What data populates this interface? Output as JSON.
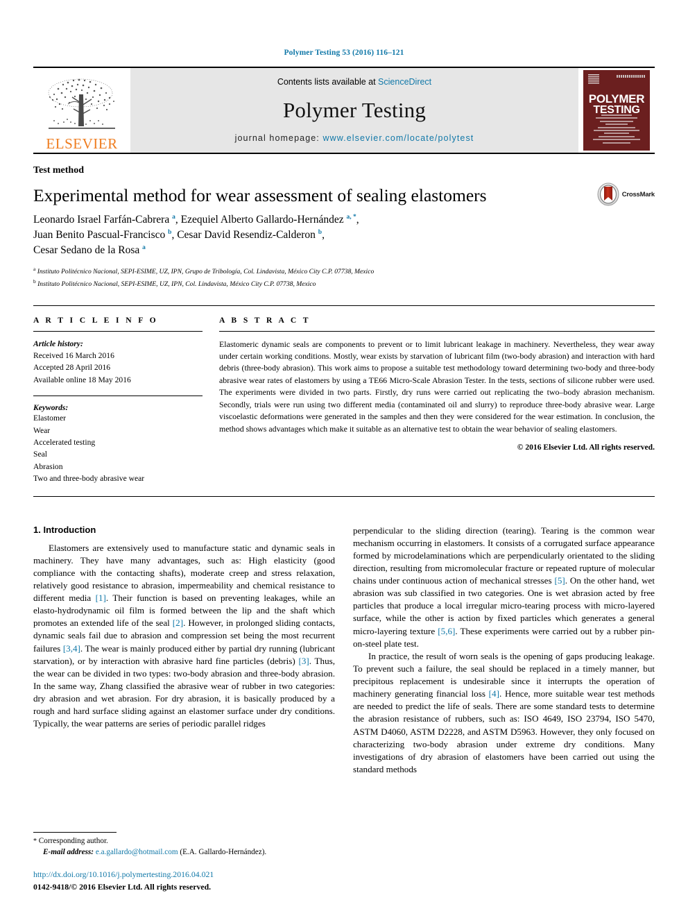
{
  "running_head": "Polymer Testing 53 (2016) 116–121",
  "header": {
    "elsevier_wordmark": "ELSEVIER",
    "contents_prefix": "Contents lists available at ",
    "contents_link": "ScienceDirect",
    "journal_title": "Polymer Testing",
    "homepage_prefix": "journal homepage: ",
    "homepage_url": "www.elsevier.com/locate/polytest",
    "cover": {
      "line1": "POLYMER",
      "line2": "TESTING"
    }
  },
  "article": {
    "type": "Test method",
    "title": "Experimental method for wear assessment of sealing elastomers",
    "crossmark_label": "CrossMark",
    "authors_html": "Leonardo Israel Farfán-Cabrera <sup>a</sup>, Ezequiel Alberto Gallardo-Hernández <sup>a, *</sup>,<br>Juan Benito Pascual-Francisco <sup>b</sup>, Cesar David Resendiz-Calderon <sup>b</sup>,<br>Cesar Sedano de la Rosa <sup>a</sup>",
    "affiliations": [
      {
        "mark": "a",
        "text": "Instituto Politécnico Nacional, SEPI-ESIME, UZ, IPN, Grupo de Tribología, Col. Lindavista, México City C.P. 07738, Mexico"
      },
      {
        "mark": "b",
        "text": "Instituto Politécnico Nacional, SEPI-ESIME, UZ, IPN, Col. Lindavista, México City C.P. 07738, Mexico"
      }
    ]
  },
  "article_info": {
    "heading": "A R T I C L E   I N F O",
    "history_heading": "Article history:",
    "history": [
      "Received 16 March 2016",
      "Accepted 28 April 2016",
      "Available online 18 May 2016"
    ],
    "keywords_heading": "Keywords:",
    "keywords": [
      "Elastomer",
      "Wear",
      "Accelerated testing",
      "Seal",
      "Abrasion",
      "Two and three-body abrasive wear"
    ]
  },
  "abstract": {
    "heading": "A B S T R A C T",
    "text": "Elastomeric dynamic seals are components to prevent or to limit lubricant leakage in machinery. Nevertheless, they wear away under certain working conditions. Mostly, wear exists by starvation of lubricant film (two-body abrasion) and interaction with hard debris (three-body abrasion). This work aims to propose a suitable test methodology toward determining two-body and three-body abrasive wear rates of elastomers by using a TE66 Micro-Scale Abrasion Tester. In the tests, sections of silicone rubber were used. The experiments were divided in two parts. Firstly, dry runs were carried out replicating the two–body abrasion mechanism. Secondly, trials were run using two different media (contaminated oil and slurry) to reproduce three-body abrasive wear. Large viscoelastic deformations were generated in the samples and then they were considered for the wear estimation. In conclusion, the method shows advantages which make it suitable as an alternative test to obtain the wear behavior of sealing elastomers.",
    "copyright": "© 2016 Elsevier Ltd. All rights reserved."
  },
  "introduction": {
    "heading": "1. Introduction",
    "left_paragraphs_html": [
      "Elastomers are extensively used to manufacture static and dynamic seals in machinery. They have many advantages, such as: High elasticity (good compliance with the contacting shafts), moderate creep and stress relaxation, relatively good resistance to abrasion, impermeability and chemical resistance to different media <span class=\"ref\">[1]</span>. Their function is based on preventing leakages, while an elasto-hydrodynamic oil film is formed between the lip and the shaft which promotes an extended life of the seal <span class=\"ref\">[2]</span>. However, in prolonged sliding contacts, dynamic seals fail due to abrasion and compression set being the most recurrent failures <span class=\"ref\">[3,4]</span>. The wear is mainly produced either by partial dry running (lubricant starvation), or by interaction with abrasive hard fine particles (debris) <span class=\"ref\">[3]</span>. Thus, the wear can be divided in two types: two-body abrasion and three-body abrasion. In the same way, Zhang classified the abrasive wear of rubber in two categories: dry abrasion and wet abrasion. For dry abrasion, it is basically produced by a rough and hard surface sliding against an elastomer surface under dry conditions. Typically, the wear patterns are series of periodic parallel ridges"
    ],
    "right_paragraphs_html": [
      "perpendicular to the sliding direction (tearing). Tearing is the common wear mechanism occurring in elastomers. It consists of a corrugated surface appearance formed by microdelaminations which are perpendicularly orientated to the sliding direction, resulting from micromolecular fracture or repeated rupture of molecular chains under continuous action of mechanical stresses <span class=\"ref\">[5]</span>. On the other hand, wet abrasion was sub classified in two categories. One is wet abrasion acted by free particles that produce a local irregular micro-tearing process with micro-layered surface, while the other is action by fixed particles which generates a general micro-layering texture <span class=\"ref\">[5,6]</span>. These experiments were carried out by a rubber pin-on-steel plate test.",
      "In practice, the result of worn seals is the opening of gaps producing leakage. To prevent such a failure, the seal should be replaced in a timely manner, but precipitous replacement is undesirable since it interrupts the operation of machinery generating financial loss <span class=\"ref\">[4]</span>. Hence, more suitable wear test methods are needed to predict the life of seals. There are some standard tests to determine the abrasion resistance of rubbers, such as: ISO 4649, ISO 23794, ISO 5470, ASTM D4060, ASTM D2228, and ASTM D5963. However, they only focused on characterizing two-body abrasion under extreme dry conditions. Many investigations of dry abrasion of elastomers have been carried out using the standard methods"
    ]
  },
  "footer": {
    "corresponding_marker": "*",
    "corresponding_text": "Corresponding author.",
    "email_label": "E-mail address:",
    "email": "e.a.gallardo@hotmail.com",
    "email_owner": "(E.A. Gallardo-Hernández).",
    "doi": "http://dx.doi.org/10.1016/j.polymertesting.2016.04.021",
    "issn_line": "0142-9418/© 2016 Elsevier Ltd. All rights reserved."
  },
  "colors": {
    "link": "#1178a8",
    "elsevier_orange": "#ef7d20",
    "cover_maroon": "#6b1f1f",
    "band_grey": "#e6e6e6"
  }
}
